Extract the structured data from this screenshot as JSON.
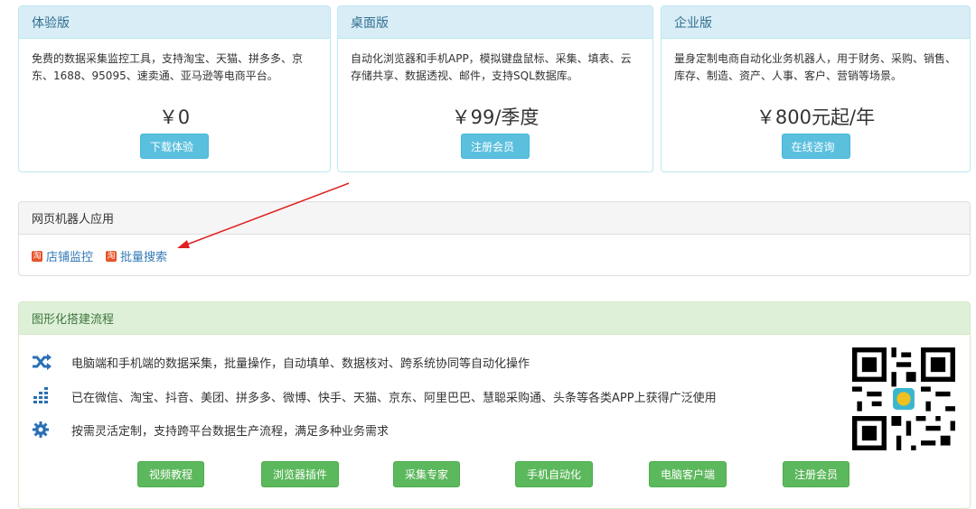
{
  "plans": [
    {
      "title": "体验版",
      "desc": "免费的数据采集监控工具，支持淘宝、天猫、拼多多、京东、1688、95095、速卖通、亚马逊等电商平台。",
      "price": "￥0",
      "button": "下载体验"
    },
    {
      "title": "桌面版",
      "desc": "自动化浏览器和手机APP，模拟键盘鼠标、采集、填表、云存储共享、数据透视、邮件，支持SQL数据库。",
      "price": "￥99/季度",
      "button": "注册会员"
    },
    {
      "title": "企业版",
      "desc": "量身定制电商自动化业务机器人，用于财务、采购、销售、库存、制造、资产、人事、客户、营销等场景。",
      "price": "￥800元起/年",
      "button": "在线咨询"
    }
  ],
  "robot": {
    "title": "网页机器人应用",
    "links": [
      {
        "label": "店铺监控",
        "icon": "app-logo-icon"
      },
      {
        "label": "批量搜索",
        "icon": "app-logo-icon"
      }
    ]
  },
  "flow": {
    "title": "图形化搭建流程",
    "features": [
      {
        "icon": "shuffle-icon",
        "text": "电脑端和手机端的数据采集，批量操作，自动填单、数据核对、跨系统协同等自动化操作"
      },
      {
        "icon": "bar-chart-icon",
        "text": "已在微信、淘宝、抖音、美团、拼多多、微博、快手、天猫、京东、阿里巴巴、慧聪采购通、头条等各类APP上获得广泛使用"
      },
      {
        "icon": "gear-icon",
        "text": "按需灵活定制，支持跨平台数据生产流程，满足多种业务需求"
      }
    ],
    "buttons": [
      "视频教程",
      "浏览器插件",
      "采集专家",
      "手机自动化",
      "电脑客户端",
      "注册会员"
    ]
  },
  "colors": {
    "info": "#5bc0de",
    "success": "#5cb85c",
    "link": "#337ab7",
    "arrow": "#e02020"
  }
}
